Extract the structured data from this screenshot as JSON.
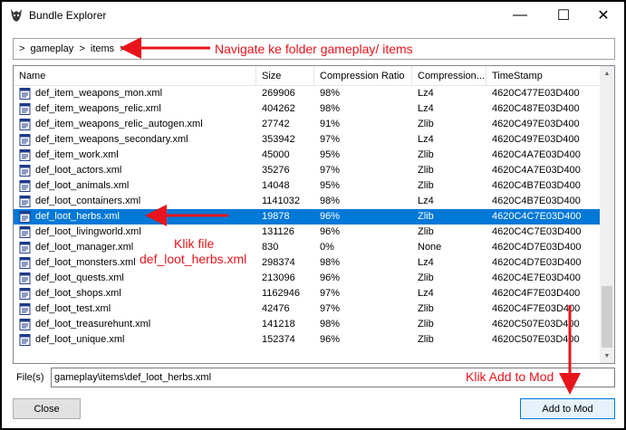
{
  "window": {
    "title": "Bundle Explorer"
  },
  "window_controls": {
    "minimize": "—",
    "maximize": "☐",
    "close": "✕"
  },
  "breadcrumb": {
    "text": ">  gameplay  >  items  >"
  },
  "columns": [
    "Name",
    "Size",
    "Compression Ratio",
    "Compression...",
    "TimeStamp"
  ],
  "rows": [
    {
      "name": "def_item_weapons_mon.xml",
      "size": "269906",
      "ratio": "98%",
      "comp": "Lz4",
      "ts": "4620C477E03D400"
    },
    {
      "name": "def_item_weapons_relic.xml",
      "size": "404262",
      "ratio": "98%",
      "comp": "Lz4",
      "ts": "4620C487E03D400"
    },
    {
      "name": "def_item_weapons_relic_autogen.xml",
      "size": "27742",
      "ratio": "91%",
      "comp": "Zlib",
      "ts": "4620C497E03D400"
    },
    {
      "name": "def_item_weapons_secondary.xml",
      "size": "353942",
      "ratio": "97%",
      "comp": "Lz4",
      "ts": "4620C497E03D400"
    },
    {
      "name": "def_item_work.xml",
      "size": "45000",
      "ratio": "95%",
      "comp": "Zlib",
      "ts": "4620C4A7E03D400"
    },
    {
      "name": "def_loot_actors.xml",
      "size": "35276",
      "ratio": "97%",
      "comp": "Zlib",
      "ts": "4620C4A7E03D400"
    },
    {
      "name": "def_loot_animals.xml",
      "size": "14048",
      "ratio": "95%",
      "comp": "Zlib",
      "ts": "4620C4B7E03D400"
    },
    {
      "name": "def_loot_containers.xml",
      "size": "1141032",
      "ratio": "98%",
      "comp": "Lz4",
      "ts": "4620C4B7E03D400"
    },
    {
      "name": "def_loot_herbs.xml",
      "size": "19878",
      "ratio": "96%",
      "comp": "Zlib",
      "ts": "4620C4C7E03D400",
      "selected": true
    },
    {
      "name": "def_loot_livingworld.xml",
      "size": "131126",
      "ratio": "96%",
      "comp": "Zlib",
      "ts": "4620C4C7E03D400"
    },
    {
      "name": "def_loot_manager.xml",
      "size": "830",
      "ratio": "0%",
      "comp": "None",
      "ts": "4620C4D7E03D400"
    },
    {
      "name": "def_loot_monsters.xml",
      "size": "298374",
      "ratio": "98%",
      "comp": "Lz4",
      "ts": "4620C4D7E03D400"
    },
    {
      "name": "def_loot_quests.xml",
      "size": "213096",
      "ratio": "96%",
      "comp": "Zlib",
      "ts": "4620C4E7E03D400"
    },
    {
      "name": "def_loot_shops.xml",
      "size": "1162946",
      "ratio": "97%",
      "comp": "Lz4",
      "ts": "4620C4F7E03D400"
    },
    {
      "name": "def_loot_test.xml",
      "size": "42476",
      "ratio": "97%",
      "comp": "Zlib",
      "ts": "4620C4F7E03D400"
    },
    {
      "name": "def_loot_treasurehunt.xml",
      "size": "141218",
      "ratio": "98%",
      "comp": "Zlib",
      "ts": "4620C507E03D400"
    },
    {
      "name": "def_loot_unique.xml",
      "size": "152374",
      "ratio": "96%",
      "comp": "Zlib",
      "ts": "4620C507E03D400"
    }
  ],
  "files": {
    "label": "File(s)",
    "value": "gameplay\\items\\def_loot_herbs.xml"
  },
  "buttons": {
    "close": "Close",
    "add_to_mod": "Add to Mod"
  },
  "annotations": {
    "navigate": "Navigate ke folder gameplay/ items",
    "klik_file_1": "Klik file",
    "klik_file_2": "def_loot_herbs.xml",
    "klik_add": "Klik Add to Mod"
  },
  "colors": {
    "selection": "#0078d7",
    "annotation": "#e8141b"
  },
  "icons": {
    "app": "wolf-medallion-icon",
    "file": "xml-file-icon"
  }
}
